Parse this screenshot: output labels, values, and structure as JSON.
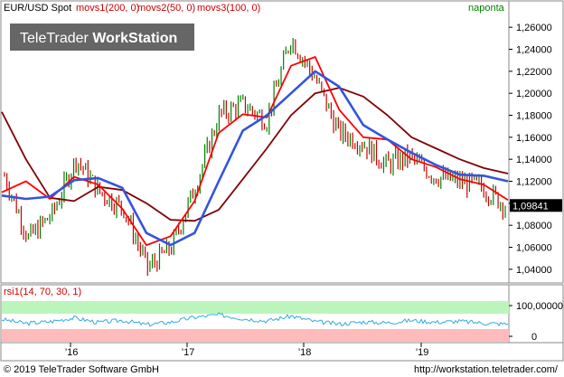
{
  "header": {
    "instrument": "EUR/USD Spot",
    "indicators": [
      {
        "label": "movs1(200, 0)",
        "color": "#cc0000"
      },
      {
        "label": "movs2(50, 0)",
        "color": "#cc0000"
      },
      {
        "label": "movs3(100, 0)",
        "color": "#cc0000"
      }
    ],
    "period": "naponta",
    "watermark": "TeleTrader WorkStation",
    "watermark_part1": "TeleTrader ",
    "watermark_part2": "WorkStation"
  },
  "price_axis": {
    "ticks": [
      "1,26000",
      "1,24000",
      "1,22000",
      "1,20000",
      "1,18000",
      "1,16000",
      "1,14000",
      "1,12000",
      "1,10000",
      "1,08000",
      "1,06000",
      "1,04000"
    ],
    "tick_values": [
      1.26,
      1.24,
      1.22,
      1.2,
      1.18,
      1.16,
      1.14,
      1.12,
      1.1,
      1.08,
      1.06,
      1.04
    ],
    "current_label": "1,09841"
  },
  "rsi_panel": {
    "label": "rsi1(14, 70, 30, 1)",
    "ticks": [
      "100,00000",
      "0"
    ]
  },
  "time_axis": {
    "labels": [
      "'16",
      "'17",
      "'18",
      "'19"
    ]
  },
  "footer": {
    "copyright": "© 2019 TeleTrader Software GmbH",
    "url": "http://workstation.teletrader.com/"
  },
  "colors": {
    "up_bar": "#008000",
    "down_bar": "#cc0000",
    "movs1_line": "#800000",
    "movs2_line": "#ff0000",
    "movs3_line": "#3355dd",
    "rsi_line": "#33aadd",
    "rsi_overbought": "#bbf5bb",
    "rsi_oversold": "#ffbbbb",
    "current_label_bg": "#000000"
  },
  "chart_data": {
    "type": "line",
    "x": [
      "2015-08",
      "2015-11",
      "2016-01",
      "2016-04",
      "2016-07",
      "2016-10",
      "2016-12",
      "2017-03",
      "2017-05",
      "2017-07",
      "2017-09",
      "2017-11",
      "2018-02",
      "2018-04",
      "2018-06",
      "2018-08",
      "2018-10",
      "2018-12",
      "2019-03",
      "2019-05",
      "2019-08",
      "2019-10"
    ],
    "series": [
      {
        "name": "movs1(200, 0)",
        "values": [
          1.183,
          1.14,
          1.105,
          1.102,
          1.115,
          1.112,
          1.1,
          1.085,
          1.084,
          1.094,
          1.122,
          1.15,
          1.18,
          1.2,
          1.205,
          1.197,
          1.18,
          1.16,
          1.15,
          1.14,
          1.132,
          1.127
        ]
      },
      {
        "name": "movs2(50, 0)",
        "values": [
          1.11,
          1.12,
          1.104,
          1.124,
          1.117,
          1.095,
          1.062,
          1.07,
          1.102,
          1.164,
          1.181,
          1.178,
          1.225,
          1.233,
          1.185,
          1.16,
          1.158,
          1.14,
          1.133,
          1.122,
          1.117,
          1.103
        ]
      },
      {
        "name": "movs3(100, 0)",
        "values": [
          1.107,
          1.104,
          1.106,
          1.121,
          1.123,
          1.114,
          1.073,
          1.062,
          1.073,
          1.12,
          1.166,
          1.18,
          1.2,
          1.22,
          1.206,
          1.171,
          1.158,
          1.146,
          1.135,
          1.126,
          1.125,
          1.12
        ]
      },
      {
        "name": "EUR/USD Spot",
        "values": [
          1.125,
          1.068,
          1.09,
          1.14,
          1.11,
          1.095,
          1.041,
          1.06,
          1.115,
          1.18,
          1.19,
          1.175,
          1.25,
          1.215,
          1.165,
          1.155,
          1.135,
          1.142,
          1.125,
          1.12,
          1.115,
          1.098
        ]
      }
    ],
    "rsi": [
      55,
      42,
      48,
      60,
      45,
      52,
      38,
      46,
      62,
      70,
      58,
      50,
      66,
      48,
      40,
      47,
      44,
      52,
      46,
      49,
      43,
      40
    ],
    "ylim": [
      1.03,
      1.27
    ],
    "rsi_ylim": [
      0,
      100
    ],
    "xlabel": "",
    "ylabel": "",
    "grid": false,
    "legend": "top-left"
  }
}
